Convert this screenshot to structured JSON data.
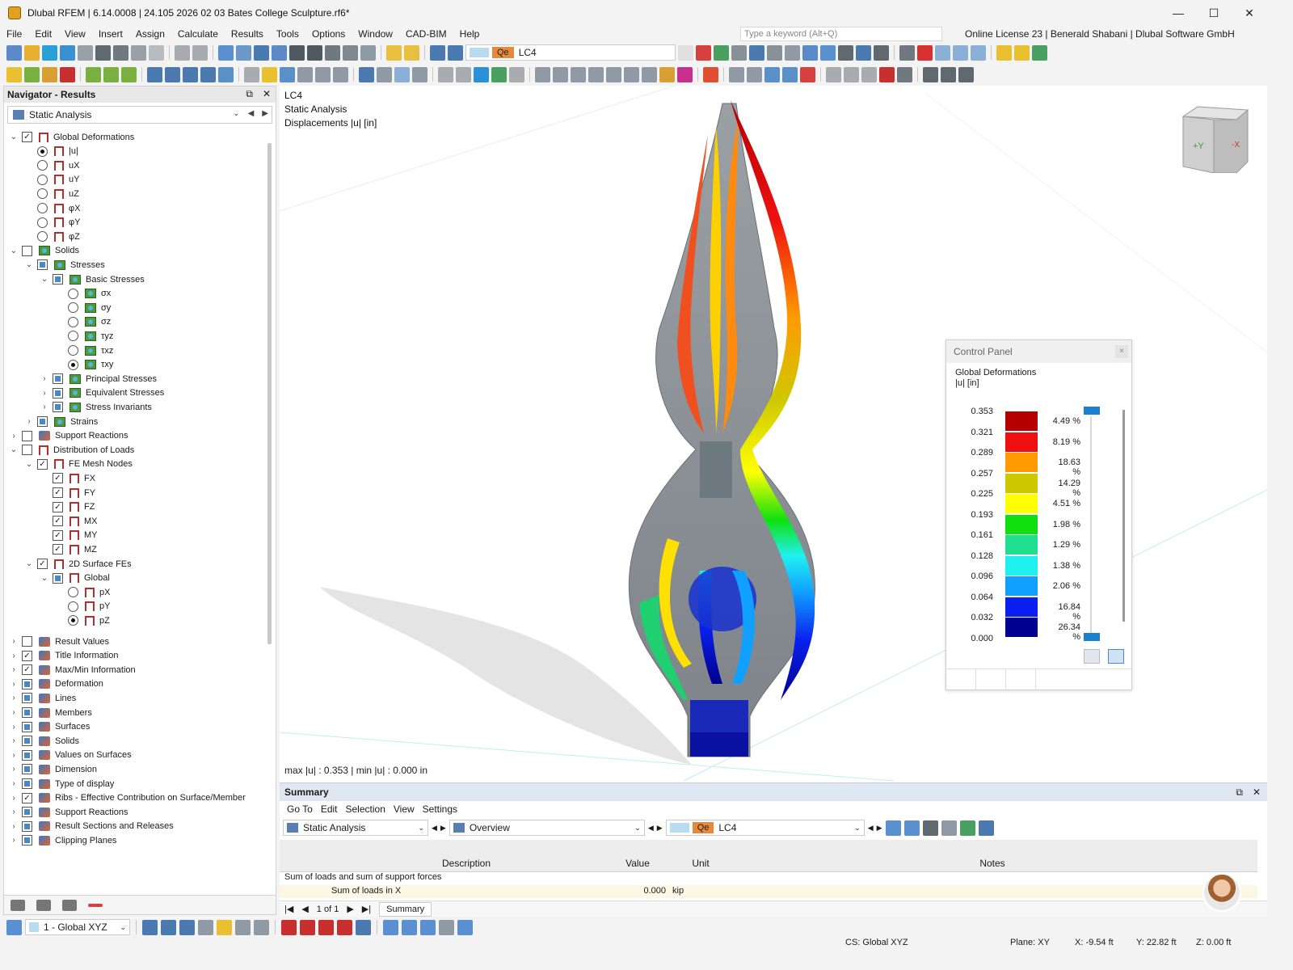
{
  "window": {
    "title": "Dlubal RFEM | 6.14.0008 | 24.105 2026 02 03 Bates College Sculpture.rf6*",
    "controls": [
      "—",
      "☐",
      "✕"
    ]
  },
  "menu": [
    "File",
    "Edit",
    "View",
    "Insert",
    "Assign",
    "Calculate",
    "Results",
    "Tools",
    "Options",
    "Window",
    "CAD-BIM",
    "Help"
  ],
  "search": {
    "placeholder": "Type a keyword (Alt+Q)"
  },
  "license": "Online License 23 | Benerald Shabani | Dlubal Software GmbH",
  "toolbar": {
    "lc_badge": "Qe",
    "lc_name": "LC4"
  },
  "navigator": {
    "title": "Navigator - Results",
    "combo": "Static Analysis",
    "tree": [
      {
        "label": "Global Deformations",
        "level": 0,
        "exp": "v",
        "ctl": "chk-on",
        "icon": "frame"
      },
      {
        "label": "|u|",
        "level": 1,
        "ctl": "rad-on",
        "icon": "frame"
      },
      {
        "label": "uX",
        "level": 1,
        "ctl": "rad",
        "icon": "frame"
      },
      {
        "label": "uY",
        "level": 1,
        "ctl": "rad",
        "icon": "frame"
      },
      {
        "label": "uZ",
        "level": 1,
        "ctl": "rad",
        "icon": "frame"
      },
      {
        "label": "φX",
        "level": 1,
        "ctl": "rad",
        "icon": "frame"
      },
      {
        "label": "φY",
        "level": 1,
        "ctl": "rad",
        "icon": "frame"
      },
      {
        "label": "φZ",
        "level": 1,
        "ctl": "rad",
        "icon": "frame"
      },
      {
        "label": "Solids",
        "level": 0,
        "exp": "v",
        "ctl": "chk",
        "icon": "solid"
      },
      {
        "label": "Stresses",
        "level": 1,
        "exp": "v",
        "ctl": "chk-part",
        "icon": "solid"
      },
      {
        "label": "Basic Stresses",
        "level": 2,
        "exp": "v",
        "ctl": "chk-part",
        "icon": "solid"
      },
      {
        "label": "σx",
        "level": 3,
        "ctl": "rad",
        "icon": "solid"
      },
      {
        "label": "σy",
        "level": 3,
        "ctl": "rad",
        "icon": "solid"
      },
      {
        "label": "σz",
        "level": 3,
        "ctl": "rad",
        "icon": "solid"
      },
      {
        "label": "τyz",
        "level": 3,
        "ctl": "rad",
        "icon": "solid"
      },
      {
        "label": "τxz",
        "level": 3,
        "ctl": "rad",
        "icon": "solid"
      },
      {
        "label": "τxy",
        "level": 3,
        "ctl": "rad-on",
        "icon": "solid"
      },
      {
        "label": "Principal Stresses",
        "level": 2,
        "exp": ">",
        "ctl": "chk-part",
        "icon": "solid"
      },
      {
        "label": "Equivalent Stresses",
        "level": 2,
        "exp": ">",
        "ctl": "chk-part",
        "icon": "solid"
      },
      {
        "label": "Stress Invariants",
        "level": 2,
        "exp": ">",
        "ctl": "chk-part",
        "icon": "solid"
      },
      {
        "label": "Strains",
        "level": 1,
        "exp": ">",
        "ctl": "chk-part",
        "icon": "solid"
      },
      {
        "label": "Support Reactions",
        "level": 0,
        "exp": ">",
        "ctl": "chk",
        "icon": "gen"
      },
      {
        "label": "Distribution of Loads",
        "level": 0,
        "exp": "v",
        "ctl": "chk",
        "icon": "frame"
      },
      {
        "label": "FE Mesh Nodes",
        "level": 1,
        "exp": "v",
        "ctl": "chk-on",
        "icon": "frame"
      },
      {
        "label": "FX",
        "level": 2,
        "ctl": "chk-on",
        "icon": "frame"
      },
      {
        "label": "FY",
        "level": 2,
        "ctl": "chk-on",
        "icon": "frame"
      },
      {
        "label": "FZ",
        "level": 2,
        "ctl": "chk-on",
        "icon": "frame"
      },
      {
        "label": "MX",
        "level": 2,
        "ctl": "chk-on",
        "icon": "frame"
      },
      {
        "label": "MY",
        "level": 2,
        "ctl": "chk-on",
        "icon": "frame"
      },
      {
        "label": "MZ",
        "level": 2,
        "ctl": "chk-on",
        "icon": "frame"
      },
      {
        "label": "2D Surface FEs",
        "level": 1,
        "exp": "v",
        "ctl": "chk-on",
        "icon": "frame"
      },
      {
        "label": "Global",
        "level": 2,
        "exp": "v",
        "ctl": "chk-part",
        "icon": "frame"
      },
      {
        "label": "pX",
        "level": 3,
        "ctl": "rad",
        "icon": "frame"
      },
      {
        "label": "pY",
        "level": 3,
        "ctl": "rad",
        "icon": "frame"
      },
      {
        "label": "pZ",
        "level": 3,
        "ctl": "rad-on",
        "icon": "frame"
      }
    ],
    "tree2": [
      {
        "label": "Result Values",
        "ctl": "chk"
      },
      {
        "label": "Title Information",
        "ctl": "chk-on"
      },
      {
        "label": "Max/Min Information",
        "ctl": "chk-on"
      },
      {
        "label": "Deformation",
        "ctl": "chk-part"
      },
      {
        "label": "Lines",
        "ctl": "chk-part"
      },
      {
        "label": "Members",
        "ctl": "chk-part"
      },
      {
        "label": "Surfaces",
        "ctl": "chk-part"
      },
      {
        "label": "Solids",
        "ctl": "chk-part"
      },
      {
        "label": "Values on Surfaces",
        "ctl": "chk-part"
      },
      {
        "label": "Dimension",
        "ctl": "chk-part"
      },
      {
        "label": "Type of display",
        "ctl": "chk-part"
      },
      {
        "label": "Ribs - Effective Contribution on Surface/Member",
        "ctl": "chk-on"
      },
      {
        "label": "Support Reactions",
        "ctl": "chk-part"
      },
      {
        "label": "Result Sections and Releases",
        "ctl": "chk-part"
      },
      {
        "label": "Clipping Planes",
        "ctl": "chk-part"
      }
    ]
  },
  "viewport": {
    "line1": "LC4",
    "line2": "Static Analysis",
    "line3": "Displacements |u| [in]",
    "maxmin": "max |u| : 0.353 | min |u| : 0.000 in",
    "cube_y": "+Y",
    "cube_x": "-X"
  },
  "control_panel": {
    "title": "Control Panel",
    "heading": "Global Deformations",
    "unit": "|u| [in]",
    "values": [
      "0.353",
      "0.321",
      "0.289",
      "0.257",
      "0.225",
      "0.193",
      "0.161",
      "0.128",
      "0.096",
      "0.064",
      "0.032",
      "0.000"
    ],
    "percents": [
      "4.49 %",
      "8.19 %",
      "18.63 %",
      "14.29 %",
      "4.51 %",
      "1.98 %",
      "1.29 %",
      "1.38 %",
      "2.06 %",
      "16.84 %",
      "26.34 %"
    ],
    "colors": [
      "#b40000",
      "#ee1010",
      "#ff9a00",
      "#cfc800",
      "#ffff00",
      "#10e010",
      "#20e090",
      "#20f0f0",
      "#10a0ff",
      "#0a20f0",
      "#00008e"
    ]
  },
  "summary": {
    "title": "Summary",
    "menu": [
      "Go To",
      "Edit",
      "Selection",
      "View",
      "Settings"
    ],
    "combo_analysis": "Static Analysis",
    "combo_overview": "Overview",
    "lc_badge": "Qe",
    "lc_name": "LC4",
    "headers": {
      "description": "Description",
      "value": "Value",
      "unit": "Unit",
      "notes": "Notes"
    },
    "group": "Sum of loads and sum of support forces",
    "row": {
      "description": "Sum of loads in X",
      "value": "0.000",
      "unit": "kip"
    },
    "pager": "1 of 1",
    "tab": "Summary"
  },
  "status": {
    "view_combo": "1 - Global XYZ",
    "cs": "CS: Global XYZ",
    "plane": "Plane: XY",
    "x": "X: -9.54 ft",
    "y": "Y: 22.82 ft",
    "z": "Z: 0.00 ft"
  }
}
